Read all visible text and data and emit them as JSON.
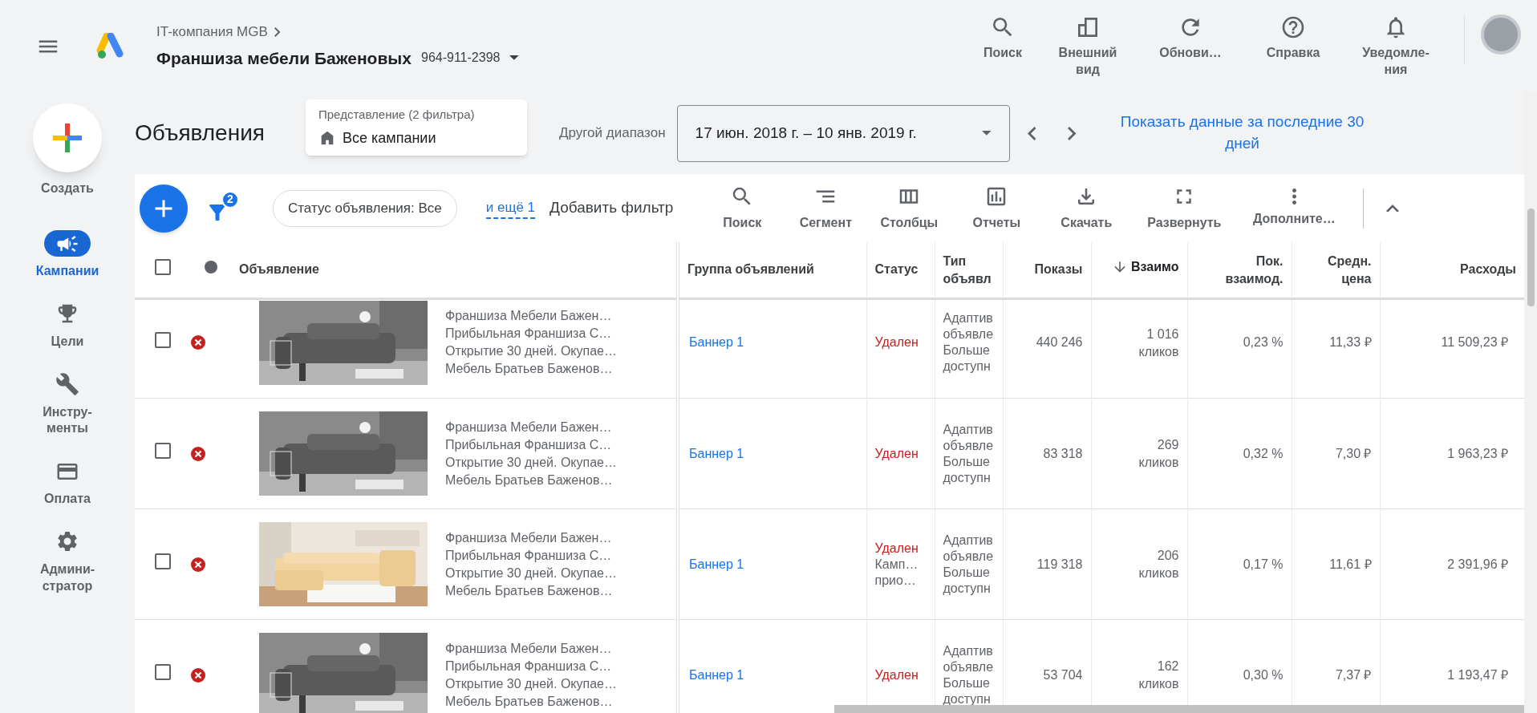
{
  "header": {
    "account_parent": "IT-компания MGB",
    "account_name": "Франшиза мебели Баженовых",
    "account_id": "964-911-2398",
    "actions": [
      {
        "kind": "search",
        "label": "Поиск"
      },
      {
        "kind": "appearance",
        "label": "Внешний\nвид"
      },
      {
        "kind": "refresh",
        "label": "Обнови…"
      },
      {
        "kind": "help",
        "label": "Справка"
      },
      {
        "kind": "notifications",
        "label": "Уведомле-\nния"
      }
    ]
  },
  "sidebar": {
    "create_label": "Создать",
    "items": [
      {
        "kind": "campaigns",
        "label": "Кампании",
        "selected": true
      },
      {
        "kind": "goals",
        "label": "Цели",
        "selected": false
      },
      {
        "kind": "tools",
        "label": "Инстру-\nменты",
        "selected": false
      },
      {
        "kind": "billing",
        "label": "Оплата",
        "selected": false
      },
      {
        "kind": "admin",
        "label": "Админи-\nстратор",
        "selected": false
      }
    ]
  },
  "page": {
    "title": "Объявления",
    "view_caption": "Представление (2 фильтра)",
    "view_value": "Все кампании",
    "range_label": "Другой диапазон",
    "date_range": "17 июн. 2018 г. – 10 янв. 2019 г.",
    "quick_link": "Показать данные за последние 30 дней"
  },
  "toolbar": {
    "filter_count": "2",
    "filter_chip": "Статус объявления: Все",
    "more_filters_link": "и ещё 1",
    "add_filter": "Добавить фильтр",
    "actions": [
      {
        "kind": "search",
        "label": "Поиск"
      },
      {
        "kind": "segment",
        "label": "Сегмент"
      },
      {
        "kind": "columns",
        "label": "Столбцы"
      },
      {
        "kind": "reports",
        "label": "Отчеты"
      },
      {
        "kind": "download",
        "label": "Скачать"
      },
      {
        "kind": "expand",
        "label": "Развернуть"
      },
      {
        "kind": "more",
        "label": "Дополните…"
      }
    ]
  },
  "table": {
    "select_all_checked": false,
    "columns": [
      {
        "label": "Объявление",
        "sorted": false
      },
      {
        "label": "Группа объявлений",
        "sorted": false
      },
      {
        "label": "Статус",
        "sorted": false
      },
      {
        "label": "Тип\nобъявл",
        "sorted": false
      },
      {
        "label": "Показы",
        "sorted": false
      },
      {
        "label": "Взаимо",
        "sorted": true
      },
      {
        "label": "Пок.\nвзаимод.",
        "sorted": false
      },
      {
        "label": "Средн.\nцена",
        "sorted": false
      },
      {
        "label": "Расходы",
        "sorted": false
      }
    ],
    "rows": [
      {
        "checked": false,
        "removed": true,
        "ad_lines": [
          "Франшиза Мебели Бажен…",
          "Прибыльная Франшиза С…",
          "Открытие 30 дней. Окупае…",
          "Мебель Братьев Баженов…"
        ],
        "ad_group": "Баннер 1",
        "status": [
          "Удален"
        ],
        "ad_type": [
          "Адаптив",
          "объявле",
          "Больше",
          "доступн"
        ],
        "impressions": "440 246",
        "interactions": [
          "1 016",
          "кликов"
        ],
        "interaction_rate": "0,23 %",
        "avg_cost": "11,33 ₽",
        "cost": "11 509,23 ₽"
      },
      {
        "checked": false,
        "removed": true,
        "ad_lines": [
          "Франшиза Мебели Бажен…",
          "Прибыльная Франшиза С…",
          "Открытие 30 дней. Окупае…",
          "Мебель Братьев Баженов…"
        ],
        "ad_group": "Баннер 1",
        "status": [
          "Удален"
        ],
        "ad_type": [
          "Адаптив",
          "объявле",
          "Больше",
          "доступн"
        ],
        "impressions": "83 318",
        "interactions": [
          "269",
          "кликов"
        ],
        "interaction_rate": "0,32 %",
        "avg_cost": "7,30 ₽",
        "cost": "1 963,23 ₽"
      },
      {
        "checked": false,
        "removed": true,
        "ad_lines": [
          "Франшиза Мебели Бажен…",
          "Прибыльная Франшиза С…",
          "Открытие 30 дней. Окупае…",
          "Мебель Братьев Баженов…"
        ],
        "ad_group": "Баннер 1",
        "status": [
          "Удален",
          "Камп…",
          "прио…"
        ],
        "ad_type": [
          "Адаптив",
          "объявле",
          "Больше",
          "доступн"
        ],
        "impressions": "119 318",
        "interactions": [
          "206",
          "кликов"
        ],
        "interaction_rate": "0,17 %",
        "avg_cost": "11,61 ₽",
        "cost": "2 391,96 ₽"
      },
      {
        "checked": false,
        "removed": true,
        "ad_lines": [
          "Франшиза Мебели Бажен…",
          "Прибыльная Франшиза С…",
          "Открытие 30 дней. Окупае…",
          "Мебель Братьев Баженов…"
        ],
        "ad_group": "Баннер 1",
        "status": [
          "Удален"
        ],
        "ad_type": [
          "Адаптив",
          "объявле",
          "Больше",
          "доступн"
        ],
        "impressions": "53 704",
        "interactions": [
          "162",
          "кликов"
        ],
        "interaction_rate": "0,30 %",
        "avg_cost": "7,37 ₽",
        "cost": "1 193,47 ₽"
      }
    ]
  }
}
